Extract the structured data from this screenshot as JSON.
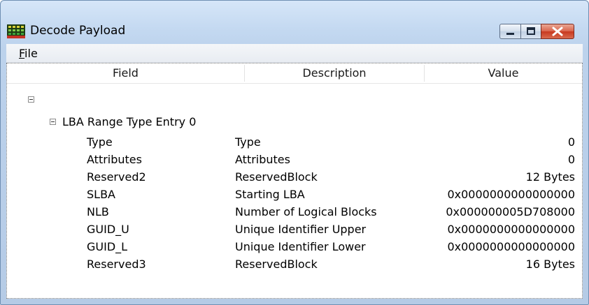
{
  "window": {
    "title": "Decode Payload",
    "icon": "app-logo-icon"
  },
  "menu": {
    "items": [
      {
        "label": "File",
        "mnemonic": "F",
        "rest": "ile"
      }
    ]
  },
  "columns": [
    "Field",
    "Description",
    "Value"
  ],
  "tree": {
    "root_label": "",
    "group_label": "LBA Range Type Entry 0",
    "rows": [
      {
        "field": "Type",
        "description": "Type",
        "value": "0"
      },
      {
        "field": "Attributes",
        "description": "Attributes",
        "value": "0"
      },
      {
        "field": "Reserved2",
        "description": "ReservedBlock",
        "value": "12 Bytes"
      },
      {
        "field": "SLBA",
        "description": "Starting LBA",
        "value": "0x0000000000000000"
      },
      {
        "field": "NLB",
        "description": "Number of Logical Blocks",
        "value": "0x000000005D708000"
      },
      {
        "field": "GUID_U",
        "description": "Unique Identifier Upper",
        "value": "0x0000000000000000"
      },
      {
        "field": "GUID_L",
        "description": "Unique Identifier Lower",
        "value": "0x0000000000000000"
      },
      {
        "field": "Reserved3",
        "description": "ReservedBlock",
        "value": "16 Bytes"
      }
    ]
  }
}
